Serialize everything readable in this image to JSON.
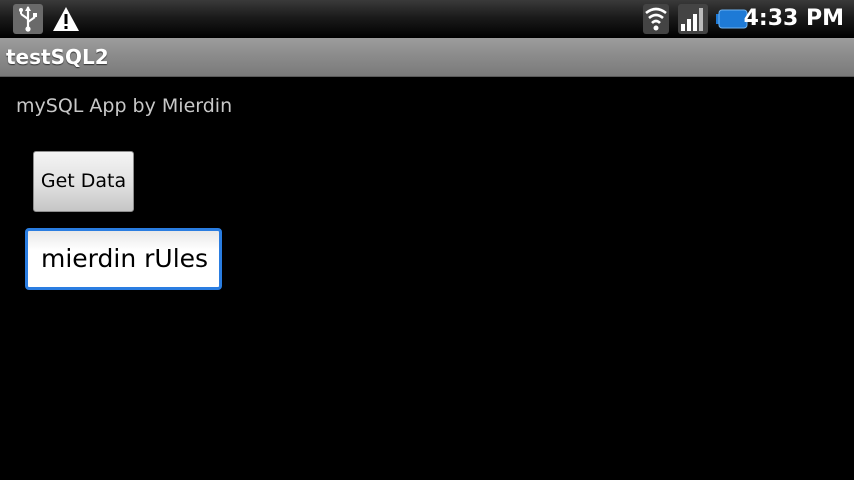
{
  "status_bar": {
    "time": "4:33 PM",
    "icons": [
      "usb-icon",
      "warning-icon",
      "wifi-icon",
      "signal-icon",
      "battery-icon"
    ]
  },
  "app": {
    "title": "testSQL2"
  },
  "main": {
    "subtitle": "mySQL App by Mierdin",
    "get_data_label": "Get Data",
    "text_field_value": "mierdin rUles"
  },
  "colors": {
    "focus_border": "#2a7de1",
    "battery": "#1e7ad6"
  }
}
